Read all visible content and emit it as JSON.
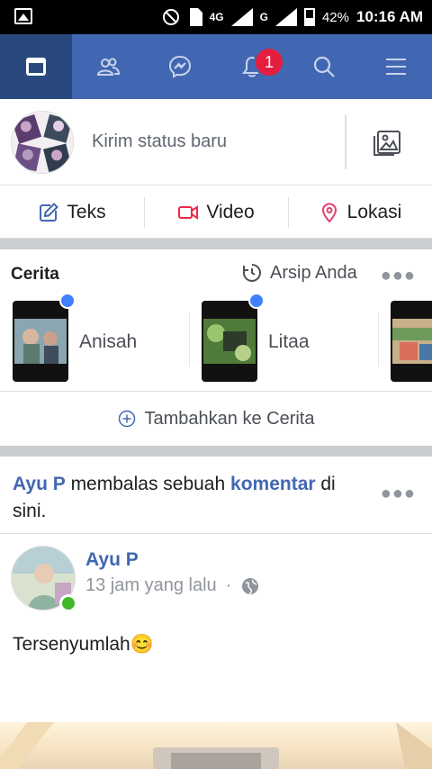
{
  "status_bar": {
    "network_1": "4G",
    "network_2": "4G",
    "network_3": "G",
    "battery": "42%",
    "time": "10:16 AM"
  },
  "nav": {
    "notification_count": "1"
  },
  "composer": {
    "placeholder": "Kirim status baru"
  },
  "actions": {
    "text": "Teks",
    "video": "Video",
    "location": "Lokasi"
  },
  "stories": {
    "title": "Cerita",
    "archive": "Arsip Anda",
    "items": [
      {
        "name": "Anisah"
      },
      {
        "name": "Litaa"
      }
    ],
    "add": "Tambahkan ke Cerita"
  },
  "notification": {
    "actor": "Ayu P",
    "middle": " membalas sebuah ",
    "object": "komentar",
    "end": " di sini."
  },
  "post": {
    "author": "Ayu P",
    "time": "13 jam yang lalu",
    "dot": "·",
    "text": "Tersenyumlah😊"
  },
  "colors": {
    "brand": "#4267b2",
    "brand_dark": "#29487d",
    "badge": "#e41e3f",
    "story_dot": "#4080ff",
    "online": "#42b72a",
    "video": "#f02849",
    "location": "#e4406f"
  }
}
